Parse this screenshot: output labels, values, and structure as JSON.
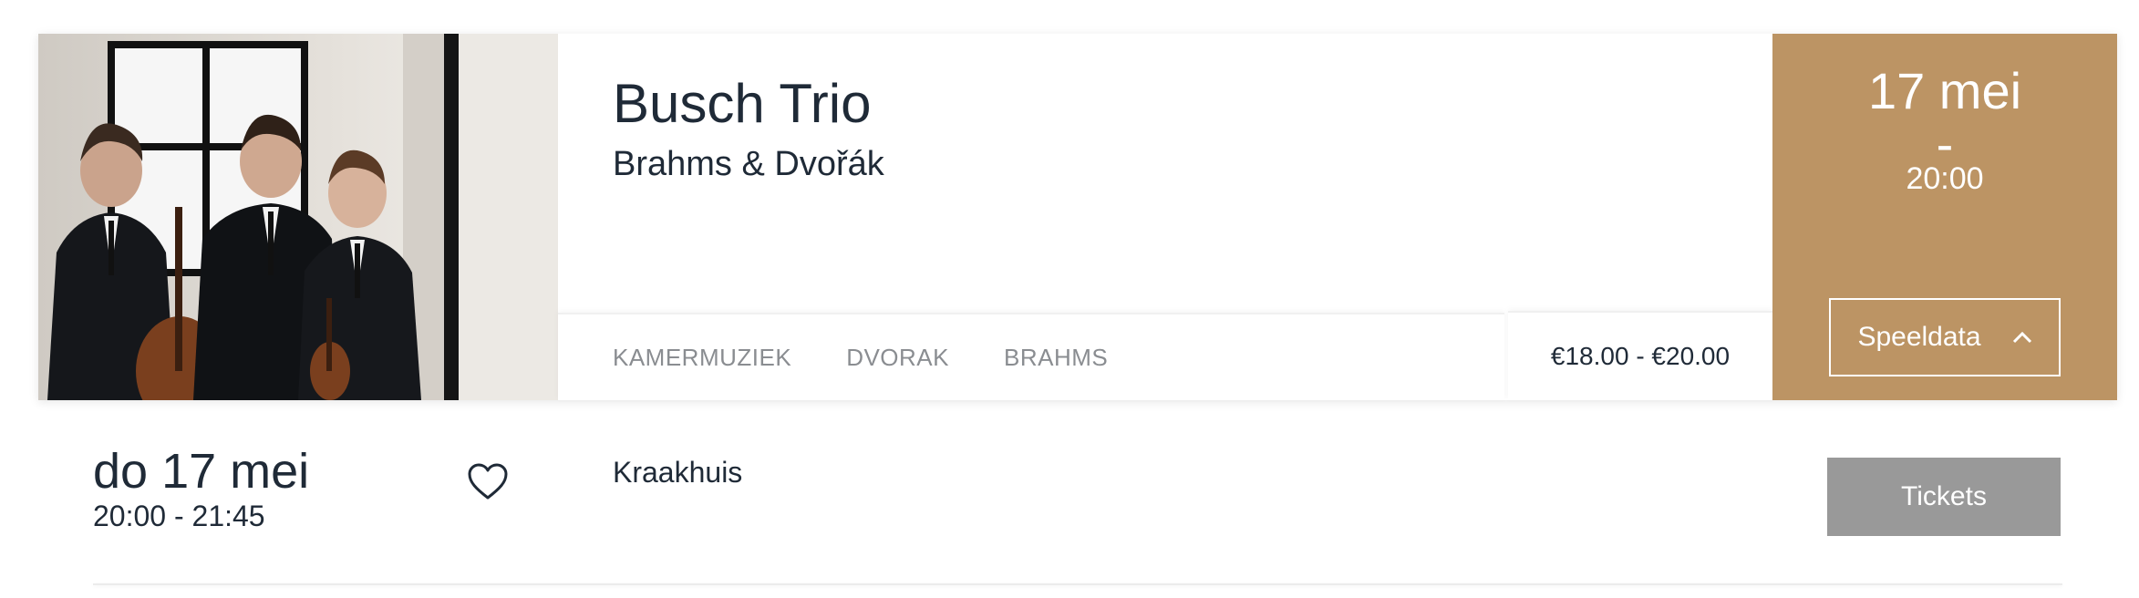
{
  "event": {
    "title": "Busch Trio",
    "subtitle": "Brahms & Dvořák",
    "image_alt": "photo-three-musicians",
    "tags": [
      "KAMERMUZIEK",
      "DVORAK",
      "BRAHMS"
    ],
    "price": "€18.00 - €20.00"
  },
  "date_panel": {
    "date": "17 mei",
    "dash": "-",
    "time": "20:00",
    "speeldata_label": "Speeldata",
    "speeldata_icon": "chevron-up-icon",
    "background": "#bc9464"
  },
  "performance": {
    "date": "do 17 mei",
    "time": "20:00 - 21:45",
    "favorite_icon": "heart-outline-icon",
    "venue": "Kraakhuis",
    "tickets_label": "Tickets"
  },
  "colors": {
    "accent": "#bc9464",
    "text": "#1f2a37",
    "muted": "#8a8d91",
    "button_gray": "#999999"
  }
}
